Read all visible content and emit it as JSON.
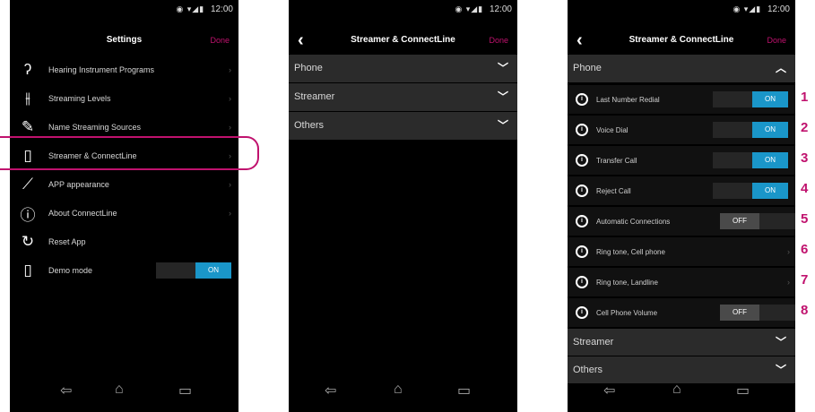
{
  "status": {
    "time": "12:00",
    "icons": "◉ ▾◢▮"
  },
  "settings_screen": {
    "title": "Settings",
    "done": "Done",
    "items": [
      {
        "label": "Hearing Instrument Programs",
        "icon": "ear-icon"
      },
      {
        "label": "Streaming Levels",
        "icon": "sliders-icon"
      },
      {
        "label": "Name Streaming Sources",
        "icon": "pencil-icon"
      },
      {
        "label": "Streamer & ConnectLine",
        "icon": "streamer-device-icon"
      },
      {
        "label": "APP appearance",
        "icon": "brush-icon"
      },
      {
        "label": "About ConnectLine",
        "icon": "info-icon"
      },
      {
        "label": "Reset App",
        "icon": "reset-icon"
      },
      {
        "label": "Demo mode",
        "icon": "phone-icon"
      }
    ],
    "demo_toggle": "ON"
  },
  "streamer_screen": {
    "title": "Streamer & ConnectLine",
    "done": "Done",
    "sections": [
      "Phone",
      "Streamer",
      "Others"
    ]
  },
  "phone_screen": {
    "title": "Streamer & ConnectLine",
    "done": "Done",
    "section_open": "Phone",
    "options": [
      {
        "label": "Last Number Redial",
        "state": "ON"
      },
      {
        "label": "Voice Dial",
        "state": "ON"
      },
      {
        "label": "Transfer Call",
        "state": "ON"
      },
      {
        "label": "Reject Call",
        "state": "ON"
      },
      {
        "label": "Automatic Connections",
        "state": "OFF"
      },
      {
        "label": "Ring tone, Cell phone",
        "state": ""
      },
      {
        "label": "Ring tone, Landline",
        "state": ""
      },
      {
        "label": "Cell Phone Volume",
        "state": "OFF"
      }
    ],
    "sections_below": [
      "Streamer",
      "Others"
    ]
  },
  "callout_numbers": [
    "1",
    "2",
    "3",
    "4",
    "5",
    "6",
    "7",
    "8"
  ],
  "colors": {
    "accent": "#c0126e",
    "toggle_on": "#1a96c9"
  }
}
